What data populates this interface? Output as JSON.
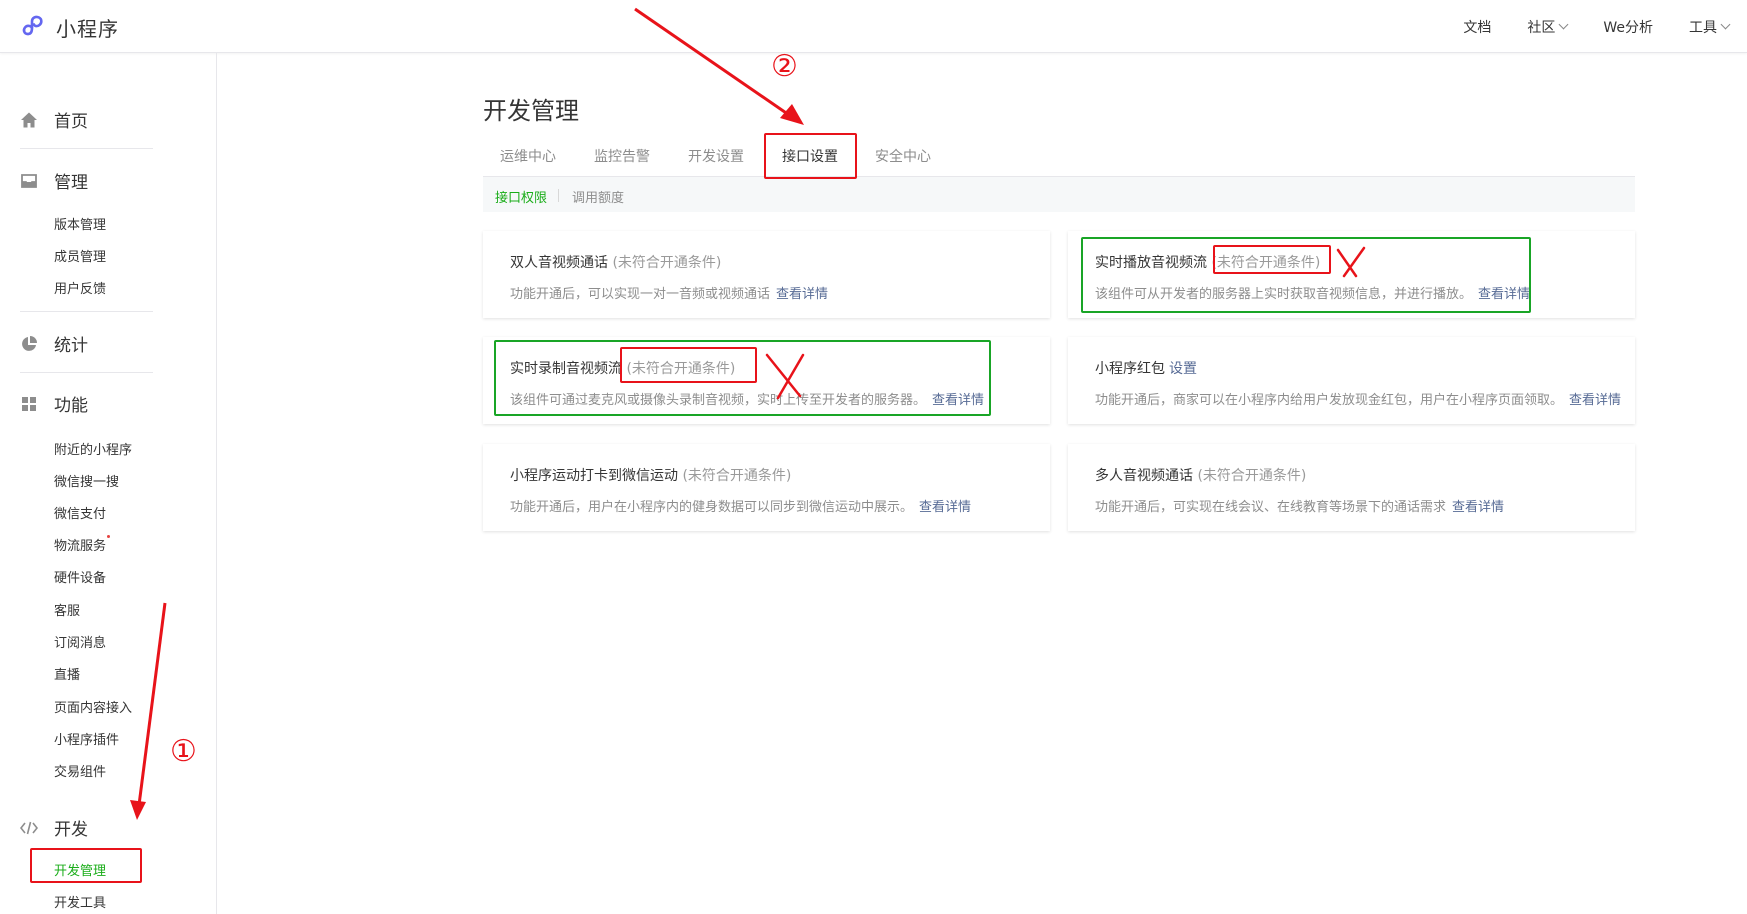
{
  "brand": {
    "name": "小程序",
    "icon": "mini-program-logo-icon"
  },
  "topnav": [
    {
      "label": "文档",
      "dropdown": false
    },
    {
      "label": "社区",
      "dropdown": true
    },
    {
      "label": "We分析",
      "dropdown": false
    },
    {
      "label": "工具",
      "dropdown": true
    }
  ],
  "sidebar": {
    "groups": [
      {
        "label": "首页",
        "icon": "home-icon",
        "items": []
      },
      {
        "label": "管理",
        "icon": "inbox-icon",
        "items": [
          "版本管理",
          "成员管理",
          "用户反馈"
        ]
      },
      {
        "label": "统计",
        "icon": "pie-chart-icon",
        "items": []
      },
      {
        "label": "功能",
        "icon": "grid-icon",
        "items": [
          "附近的小程序",
          "微信搜一搜",
          "微信支付",
          "物流服务",
          "硬件设备",
          "客服",
          "订阅消息",
          "直播",
          "页面内容接入",
          "小程序插件",
          "交易组件"
        ]
      },
      {
        "label": "开发",
        "icon": "code-icon",
        "items": [
          "开发管理",
          "开发工具"
        ]
      }
    ],
    "active_item": "开发管理"
  },
  "main": {
    "title": "开发管理",
    "tabs": [
      "运维中心",
      "监控告警",
      "开发设置",
      "接口设置",
      "安全中心"
    ],
    "active_tab": "接口设置",
    "subtabs": [
      "接口权限",
      "调用额度"
    ],
    "active_subtab": "接口权限",
    "cards": [
      {
        "title": "双人音视频通话",
        "status": "(未符合开通条件)",
        "desc": "功能开通后，可以实现一对一音频或视频通话",
        "link": "查看详情"
      },
      {
        "title": "实时播放音视频流",
        "status": "(未符合开通条件)",
        "desc": "该组件可从开发者的服务器上实时获取音视频信息，并进行播放。",
        "link": "查看详情"
      },
      {
        "title": "实时录制音视频流",
        "status": "(未符合开通条件)",
        "desc": "该组件可通过麦克风或摄像头录制音视频，实时上传至开发者的服务器。",
        "link": "查看详情"
      },
      {
        "title": "小程序红包",
        "status": "",
        "title_link": "设置",
        "desc": "功能开通后，商家可以在小程序内给用户发放现金红包，用户在小程序页面领取。",
        "link": "查看详情"
      },
      {
        "title": "小程序运动打卡到微信运动",
        "status": "(未符合开通条件)",
        "desc": "功能开通后，用户在小程序内的健身数据可以同步到微信运动中展示。",
        "link": "查看详情"
      },
      {
        "title": "多人音视频通话",
        "status": "(未符合开通条件)",
        "desc": "功能开通后，可实现在线会议、在线教育等场景下的通话需求",
        "link": "查看详情"
      }
    ]
  },
  "annotations": {
    "step1": "①",
    "step2": "②",
    "red": "#e8131a",
    "green": "#19a526"
  },
  "colors": {
    "accent_green": "#1aad19",
    "link_blue": "#576b95",
    "muted_gray": "#8d8d8d"
  }
}
